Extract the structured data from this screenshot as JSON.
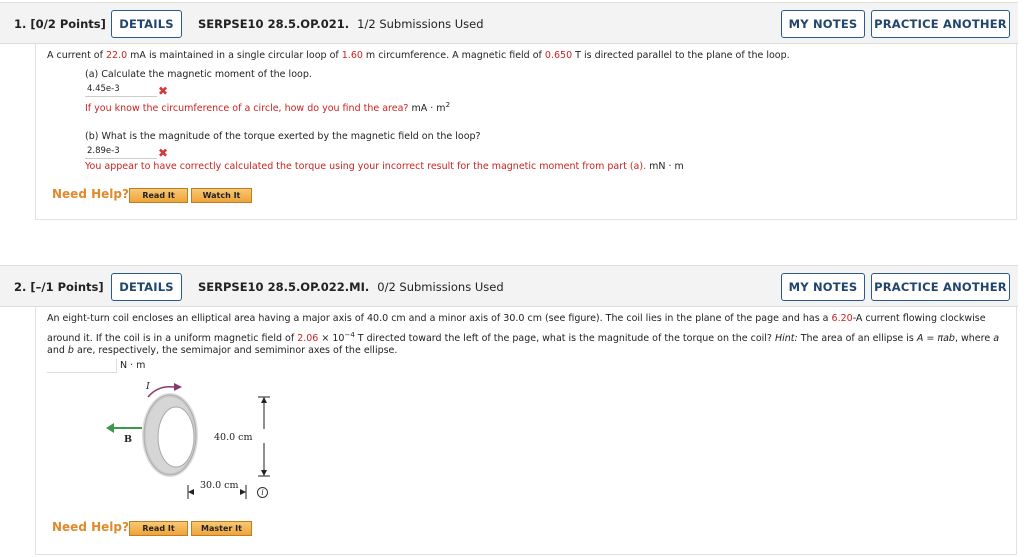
{
  "q1": {
    "number": "1.  [0/2 Points]",
    "details": "DETAILS",
    "code": "SERPSE10 28.5.OP.021.",
    "submissions": "1/2 Submissions Used",
    "my_notes": "MY NOTES",
    "practice": "PRACTICE ANOTHER",
    "stem_1": "A current of ",
    "current": "22.0",
    "stem_2": " mA is maintained in a single circular loop of ",
    "circ": "1.60",
    "stem_3": " m circumference. A magnetic field of ",
    "field": "0.650",
    "stem_4": " T is directed parallel to the plane of the loop.",
    "part_a": "(a) Calculate the magnetic moment of the loop.",
    "answer_a": "4.45e-3",
    "feedback_a": "If you know the circumference of a circle, how do you find the area?",
    "unit_a": "mA · m",
    "unit_a_exp": "2",
    "part_b": "(b) What is the magnitude of the torque exerted by the magnetic field on the loop?",
    "answer_b": "2.89e-3",
    "feedback_b": "You appear to have correctly calculated the torque using your incorrect result for the magnetic moment from part (a).",
    "unit_b": "mN · m",
    "need_help": "Need Help?",
    "read_it": "Read It",
    "watch_it": "Watch It"
  },
  "q2": {
    "number": "2.  [–/1 Points]",
    "details": "DETAILS",
    "code": "SERPSE10 28.5.OP.022.MI.",
    "submissions": "0/2 Submissions Used",
    "my_notes": "MY NOTES",
    "practice": "PRACTICE ANOTHER",
    "line1_a": "An eight-turn coil encloses an elliptical area having a major axis of 40.0 cm and a minor axis of 30.0 cm (see figure). The coil lies in the plane of the page and has a ",
    "current": "6.20",
    "line1_b": "-A current flowing clockwise",
    "line2_a": "around it. If the coil is in a uniform magnetic field of ",
    "field": "2.06",
    "times": " × 10",
    "exp": "−4",
    "line2_b": " T directed toward the left of the page, what is the magnitude of the torque on the coil? ",
    "hint": "Hint:",
    "line2_c": " The area of an ellipse is ",
    "formula": "A = πab",
    "line2_d": ", where ",
    "a_var": "a",
    "line3_a": "and ",
    "b_var": "b",
    "line3_b": " are, respectively, the semimajor and semiminor axes of the ellipse.",
    "unit": "N · m",
    "fig_I": "I",
    "fig_B": "B",
    "fig_40": "40.0 cm",
    "fig_30": "30.0 cm",
    "info": "i",
    "need_help": "Need Help?",
    "read_it": "Read It",
    "master_it": "Master It"
  }
}
